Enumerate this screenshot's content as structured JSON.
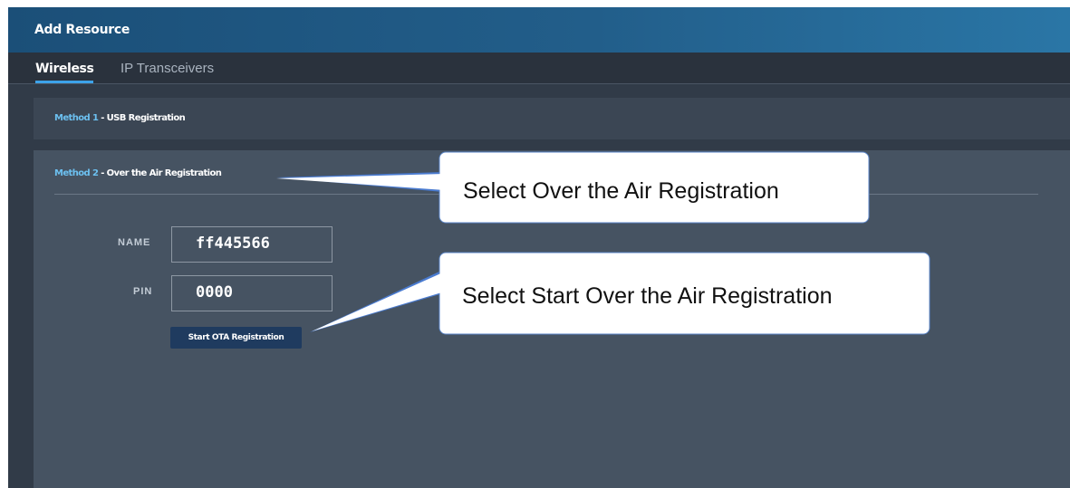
{
  "window": {
    "title": "Add Resource"
  },
  "tabs": [
    {
      "label": "Wireless",
      "active": true
    },
    {
      "label": "IP Transceivers",
      "active": false
    }
  ],
  "method1": {
    "prefix": "Method 1",
    "separator": " - ",
    "label": "USB Registration"
  },
  "method2": {
    "prefix": "Method 2",
    "separator": " - ",
    "label": "Over the Air Registration",
    "fields": {
      "name": {
        "label": "NAME",
        "value": "ff445566"
      },
      "pin": {
        "label": "PIN",
        "value": "0000"
      }
    },
    "start_button_label": "Start OTA Registration"
  },
  "callouts": {
    "select_ota": "Select Over the Air Registration",
    "select_start_ota": "Select Start Over the Air Registration"
  },
  "colors": {
    "title_bar": "#225e8a",
    "accent": "#3da3ea",
    "method_number": "#6cc0f0",
    "button": "#1f3b5f"
  }
}
